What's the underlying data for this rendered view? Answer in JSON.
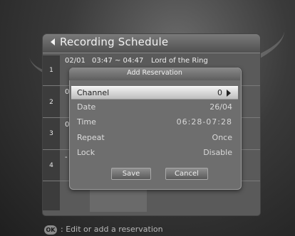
{
  "header": {
    "title": "Recording Schedule"
  },
  "schedule": {
    "rows": [
      {
        "num": "1",
        "date": "02/01",
        "time": "03:47 ~ 04:47",
        "program": "Lord of the Ring"
      },
      {
        "num": "2",
        "date": "0"
      },
      {
        "num": "3",
        "date": "0"
      },
      {
        "num": "4",
        "date": "-"
      }
    ]
  },
  "dialog": {
    "title": "Add Reservation",
    "fields": [
      {
        "label": "Channel",
        "value": "0"
      },
      {
        "label": "Date",
        "value": "26/04"
      },
      {
        "label": "Time",
        "value": "06:28-07:28"
      },
      {
        "label": "Repeat",
        "value": "Once"
      },
      {
        "label": "Lock",
        "value": "Disable"
      }
    ],
    "save_label": "Save",
    "cancel_label": "Cancel"
  },
  "footer": {
    "ok_label": "OK",
    "hint": ": Edit or add a reservation"
  },
  "colors": {
    "panel": "#5a5a5a",
    "dialog": "#6e6e6e",
    "selected_row": "#e0e0e0"
  }
}
